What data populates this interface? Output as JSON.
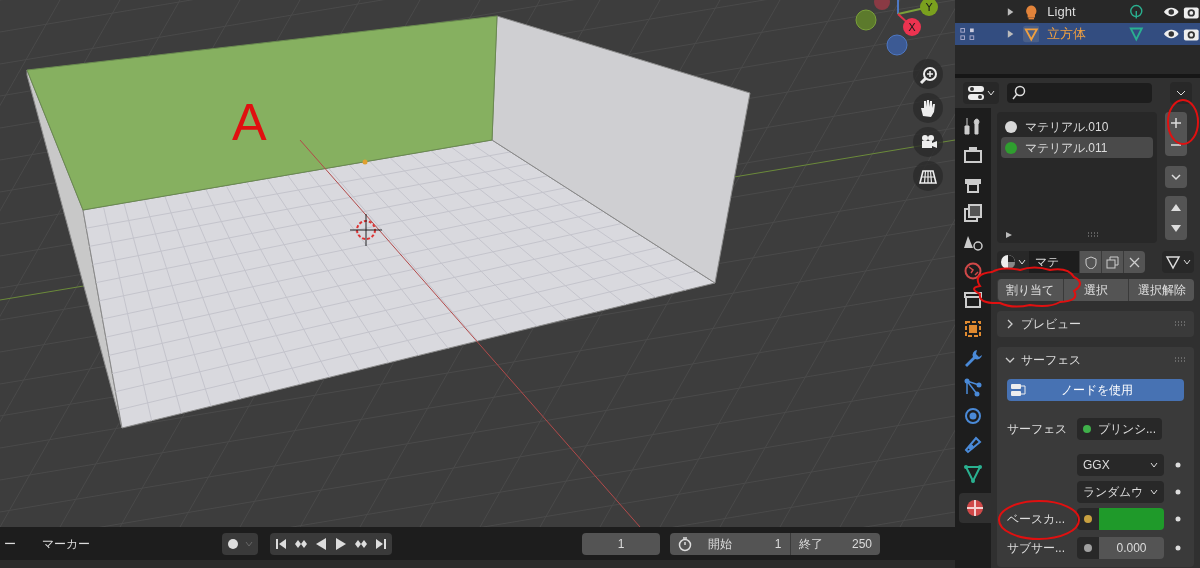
{
  "viewport": {
    "annotation_label": "A",
    "gizmo": {
      "x_label": "X",
      "y_label": "Y"
    }
  },
  "outliner": {
    "rows": [
      {
        "name": "Light",
        "kind": "light",
        "selected": false
      },
      {
        "name": "立方体",
        "kind": "mesh",
        "selected": true
      }
    ]
  },
  "properties": {
    "material_slots": [
      {
        "name": "マテリアル.010",
        "selected": false,
        "color": "#d8d8d8"
      },
      {
        "name": "マテリアル.011",
        "selected": true,
        "color": "#2f9e2f"
      }
    ],
    "material_name": "マテ",
    "buttons": [
      "割り当て",
      "選択",
      "選択解除"
    ],
    "panels": [
      {
        "title": "プレビュー",
        "expanded": false
      },
      {
        "title": "サーフェス",
        "expanded": true
      }
    ],
    "use_nodes_button": "ノードを使用",
    "surface": {
      "label": "サーフェス",
      "value": "プリンシ..."
    },
    "dropdowns": [
      "GGX",
      "ランダムウ"
    ],
    "fields": [
      {
        "label": "ベースカ...",
        "kind": "color",
        "color": "#1f9a2a"
      },
      {
        "label": "サブサー...",
        "kind": "number",
        "value": "0.000"
      }
    ]
  },
  "timeline": {
    "auto_keying": false,
    "menu_items": [
      "ー",
      "マーカー"
    ],
    "current_frame": "1",
    "start_label": "開始",
    "start": "1",
    "end_label": "終了",
    "end": "250"
  }
}
